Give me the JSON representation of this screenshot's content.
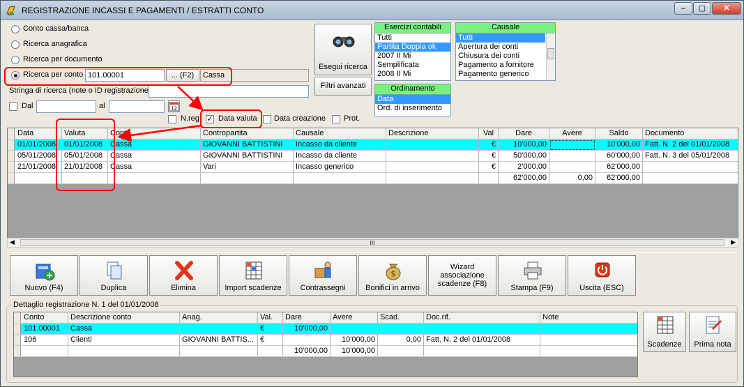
{
  "window": {
    "title": "REGISTRAZIONE INCASSI E PAGAMENTI / ESTRATTI CONTO"
  },
  "search": {
    "options": [
      "Conto cassa/banca",
      "Ricerca anagrafica",
      "Ricerca per documento",
      "Ricerca per conto"
    ],
    "selected_option": "Ricerca per conto",
    "conto_value": "101.00001",
    "f2_label": "... (F2)",
    "conto_name": "Cassa",
    "string_label": "Stringa di ricerca (note o ID registrazione)",
    "string_value": "",
    "dal_label": "Dal",
    "al_label": "al",
    "dal_value": "",
    "al_value": "",
    "calendar_day": "12",
    "checks": [
      {
        "label": "N.reg",
        "checked": false
      },
      {
        "label": "Data valuta",
        "checked": true
      },
      {
        "label": "Data creazione",
        "checked": false
      },
      {
        "label": "Prot.",
        "checked": false
      }
    ],
    "esegui_label": "Esegui ricerca",
    "filtri_label": "Filtri avanzati"
  },
  "esercizi": {
    "header": "Esercizi contabili",
    "items": [
      "Tutti",
      "Partita Doppia ok",
      "2007 II Mi",
      "Semplificata",
      "2008 II Mi"
    ],
    "selected": "Partita Doppia ok"
  },
  "ordinamento": {
    "header": "Ordinamento",
    "items": [
      "Data",
      "Ord. di inserimento"
    ],
    "selected": "Data"
  },
  "causale": {
    "header": "Causale",
    "items": [
      "Tutti",
      "Apertura dei conti",
      "Chiusura dei conti",
      "Pagamento a fornitore",
      "Pagamento generico"
    ],
    "selected": "Tutti"
  },
  "main_grid": {
    "columns": [
      "Data",
      "Valuta",
      "Conto",
      "Contropartita",
      "Causale",
      "Descrizione",
      "Val",
      "Dare",
      "Avere",
      "Saldo",
      "Documento"
    ],
    "rows": [
      {
        "data": "01/01/2008",
        "valuta": "01/01/2008",
        "conto": "Cassa",
        "contropartita": "GIOVANNI BATTISTINI",
        "causale": "Incasso da cliente",
        "descrizione": "",
        "val": "€",
        "dare": "10'000,00",
        "avere": "",
        "saldo": "10'000,00",
        "documento": "Fatt. N. 2 del 01/01/2008"
      },
      {
        "data": "05/01/2008",
        "valuta": "05/01/2008",
        "conto": "Cassa",
        "contropartita": "GIOVANNI BATTISTINI",
        "causale": "Incasso da cliente",
        "descrizione": "",
        "val": "€",
        "dare": "50'000,00",
        "avere": "",
        "saldo": "60'000,00",
        "documento": "Fatt. N. 3 del 05/01/2008"
      },
      {
        "data": "21/01/2008",
        "valuta": "21/01/2008",
        "conto": "Cassa",
        "contropartita": "Vari",
        "causale": "Incasso generico",
        "descrizione": "",
        "val": "€",
        "dare": "2'000,00",
        "avere": "",
        "saldo": "62'000,00",
        "documento": ""
      },
      {
        "data": "",
        "valuta": "",
        "conto": "",
        "contropartita": "",
        "causale": "",
        "descrizione": "",
        "val": "",
        "dare": "62'000,00",
        "avere": "0,00",
        "saldo": "62'000,00",
        "documento": ""
      }
    ],
    "scroll_glyph": "III"
  },
  "toolbar": [
    {
      "label": "Nuovo (F4)",
      "icon": "new-icon"
    },
    {
      "label": "Duplica",
      "icon": "duplicate-icon"
    },
    {
      "label": "Elimina",
      "icon": "delete-icon"
    },
    {
      "label": "Import scadenze",
      "icon": "import-icon"
    },
    {
      "label": "Contrassegni",
      "icon": "contrassegni-icon"
    },
    {
      "label": "Bonifici in arrivo",
      "icon": "money-bag-icon"
    },
    {
      "label": "Wizard associazione scadenze (F8)",
      "icon": ""
    },
    {
      "label": "Stampa (F9)",
      "icon": "printer-icon"
    },
    {
      "label": "Uscita (ESC)",
      "icon": "power-icon"
    }
  ],
  "detail": {
    "title": "Dettaglio registrazione N. 1 del 01/01/2008",
    "columns": [
      "Conto",
      "Descrizione conto",
      "Anag.",
      "Val.",
      "Dare",
      "Avere",
      "Scad.",
      "Doc.rif.",
      "Note"
    ],
    "rows": [
      {
        "conto": "101.00001",
        "descrizione": "Cassa",
        "anag": "",
        "val": "€",
        "dare": "10'000,00",
        "avere": "",
        "scad": "",
        "docrif": "",
        "note": ""
      },
      {
        "conto": "106",
        "descrizione": "Clienti",
        "anag": "GIOVANNI BATTIS...",
        "val": "€",
        "dare": "",
        "avere": "10'000,00",
        "scad": "0,00",
        "docrif": "Fatt. N. 2 del 01/01/2008",
        "note": ""
      },
      {
        "conto": "",
        "descrizione": "",
        "anag": "",
        "val": "",
        "dare": "10'000,00",
        "avere": "10'000,00",
        "scad": "",
        "docrif": "",
        "note": ""
      }
    ],
    "scadenze_label": "Scadenze",
    "primanota_label": "Prima nota"
  },
  "colors": {
    "selected_row": "#00ffff",
    "list_header": "#7cf27e",
    "highlight": "#ff0000",
    "selection": "#3399ff"
  }
}
